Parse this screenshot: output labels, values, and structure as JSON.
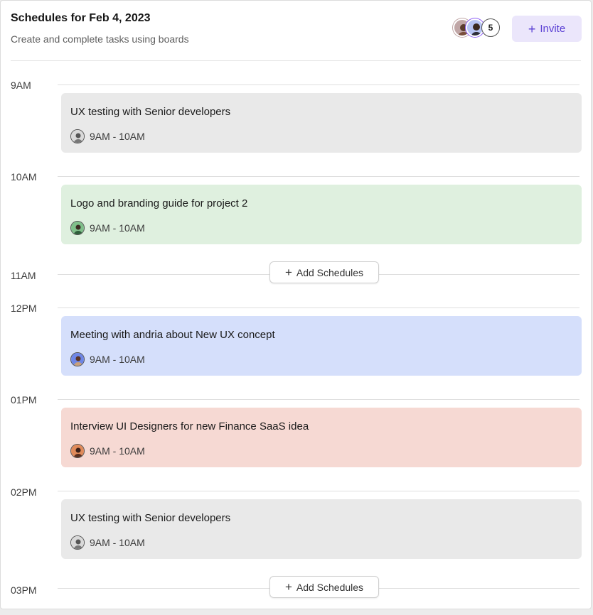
{
  "header": {
    "title": "Schedules for Feb 4, 2023",
    "subtitle": "Create and complete tasks using boards",
    "member_count": "5",
    "invite_label": "Invite"
  },
  "timeline": {
    "slots": [
      "9AM",
      "10AM",
      "11AM",
      "12PM",
      "01PM",
      "02PM",
      "03PM"
    ]
  },
  "events": [
    {
      "title": "UX testing with Senior developers",
      "time": "9AM - 10AM",
      "color": "#e9e9e9",
      "avatar": "person-gray-avatar-icon"
    },
    {
      "title": "Logo and branding guide for project 2",
      "time": "9AM - 10AM",
      "color": "#dff0df",
      "avatar": "person-green-avatar-icon"
    },
    {
      "title": "Meeting with andria about New UX concept",
      "time": "9AM - 10AM",
      "color": "#d5dffb",
      "avatar": "person-blue-avatar-icon"
    },
    {
      "title": "Interview UI Designers for new Finance SaaS idea",
      "time": "9AM - 10AM",
      "color": "#f6d9d3",
      "avatar": "person-orange-avatar-icon"
    },
    {
      "title": "UX testing with Senior developers",
      "time": "9AM - 10AM",
      "color": "#e9e9e9",
      "avatar": "person-gray-avatar-icon"
    }
  ],
  "actions": {
    "add_schedules_label": "Add Schedules"
  },
  "colors": {
    "accent": "#5a3fd4",
    "accent_bg": "#ebe6fb"
  }
}
